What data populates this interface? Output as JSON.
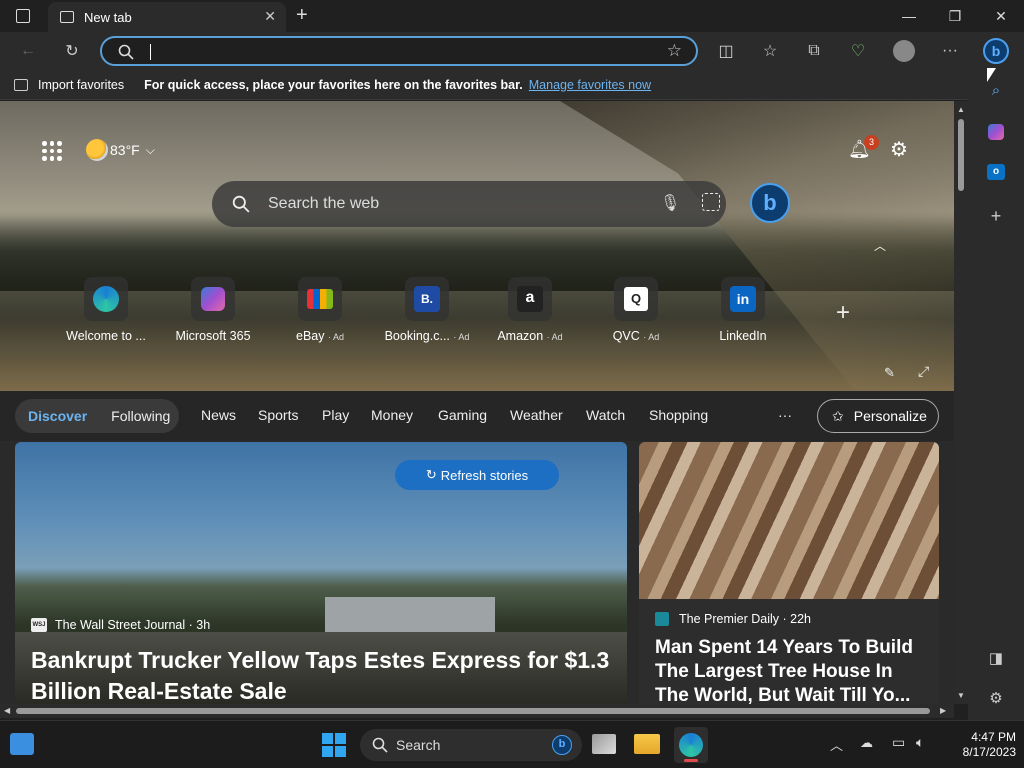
{
  "browser": {
    "tab_title": "New tab",
    "address_value": ""
  },
  "favorites_bar": {
    "import_label": "Import favorites",
    "message": "For quick access, place your favorites here on the favorites bar.",
    "manage_link": "Manage favorites now"
  },
  "newtab": {
    "weather": "83°F",
    "notifications_count": "3",
    "search_placeholder": "Search the web",
    "tiles": [
      {
        "label": "Welcome to ...",
        "ad": "",
        "icon": "edge-icon",
        "color": "#1a7fd4"
      },
      {
        "label": "Microsoft 365",
        "ad": "",
        "icon": "m365-icon",
        "color": "#8a5cd6"
      },
      {
        "label": "eBay",
        "ad": "· Ad",
        "icon": "ebay-icon",
        "color": "#e53238"
      },
      {
        "label": "Booking.c...",
        "ad": "· Ad",
        "icon": "booking-icon",
        "color": "#1f4ba4",
        "glyph": "B."
      },
      {
        "label": "Amazon",
        "ad": "· Ad",
        "icon": "amazon-icon",
        "color": "#222222",
        "glyph": "a"
      },
      {
        "label": "QVC",
        "ad": "· Ad",
        "icon": "qvc-icon",
        "color": "#ffffff",
        "glyph": "Q"
      },
      {
        "label": "LinkedIn",
        "ad": "",
        "icon": "linkedin-icon",
        "color": "#0a66c2",
        "glyph": "in"
      }
    ]
  },
  "feed_nav": {
    "discover": "Discover",
    "following": "Following",
    "links": [
      "News",
      "Sports",
      "Play",
      "Money",
      "Gaming",
      "Weather",
      "Watch",
      "Shopping"
    ],
    "more": "···",
    "personalize": "Personalize"
  },
  "cards": [
    {
      "refresh_label": "Refresh stories",
      "source": "The Wall Street Journal · 3h",
      "source_badge": "WSJ",
      "headline": "Bankrupt Trucker Yellow Taps Estes Express for $1.3 Billion Real-Estate Sale"
    },
    {
      "source": "The Premier Daily · 22h",
      "headline": "Man Spent 14 Years To Build The Largest Tree House In The World, But Wait Till Yo..."
    }
  ],
  "taskbar": {
    "search_label": "Search",
    "time": "4:47 PM",
    "date": "8/17/2023"
  },
  "colors": {
    "accent": "#5aa0d8",
    "link": "#6cb4f0",
    "refresh_button": "#1c6fc2",
    "badge": "#c8401f"
  }
}
